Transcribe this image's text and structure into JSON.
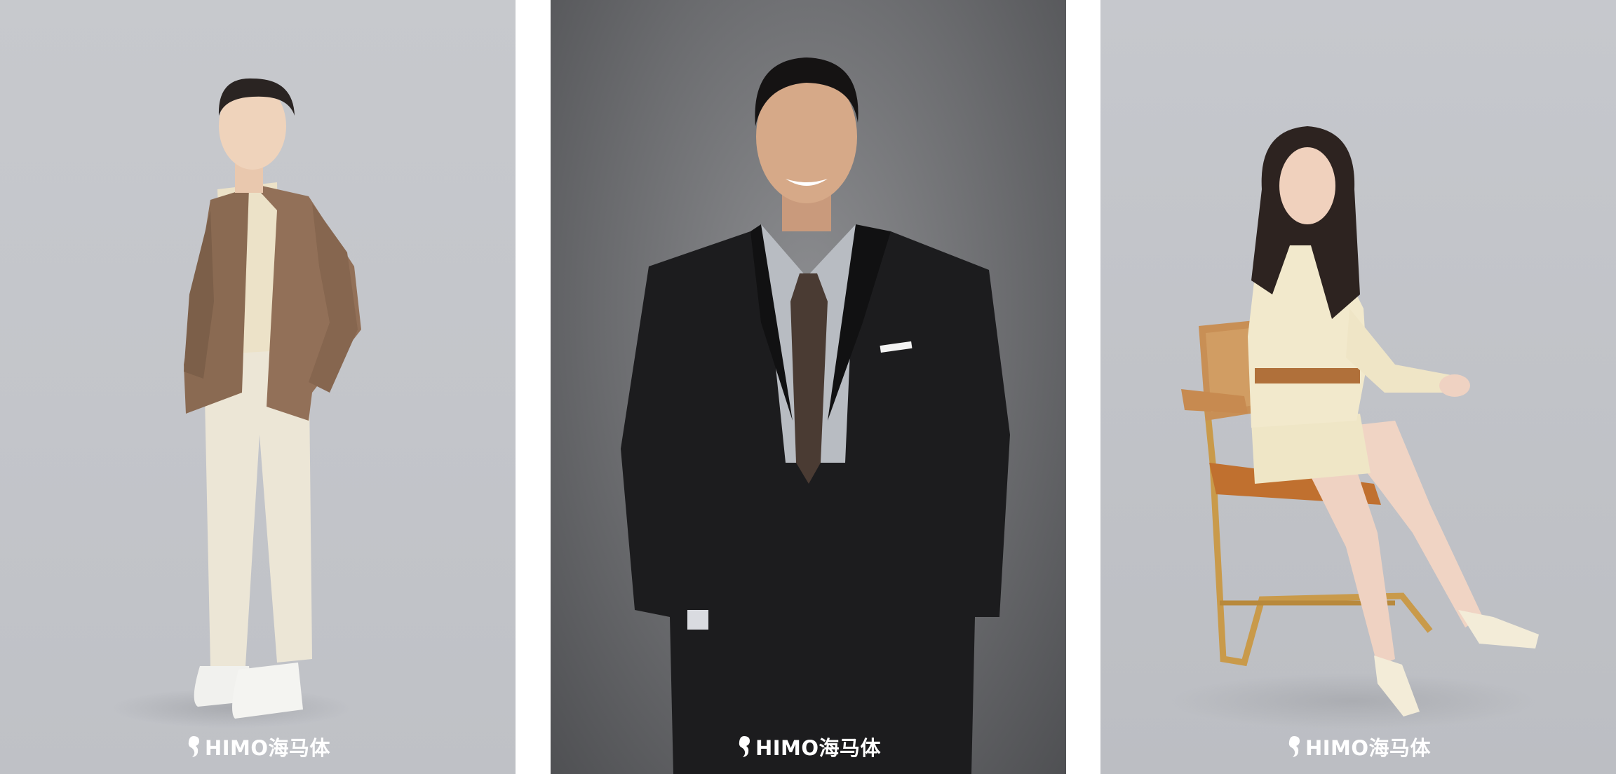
{
  "panels": [
    {
      "id": "panel-1",
      "watermark": {
        "icon": "seahorse-logo-icon",
        "text": "HIMO海马体"
      }
    },
    {
      "id": "panel-2",
      "watermark": {
        "icon": "seahorse-logo-icon",
        "text": "HIMO海马体"
      }
    },
    {
      "id": "panel-3",
      "watermark": {
        "icon": "seahorse-logo-icon",
        "text": "HIMO海马体"
      }
    }
  ],
  "colors": {
    "panel_light_gray": "#c5c7cc",
    "panel_dark_gray": "#6b6c6f",
    "watermark": "#ffffff"
  }
}
